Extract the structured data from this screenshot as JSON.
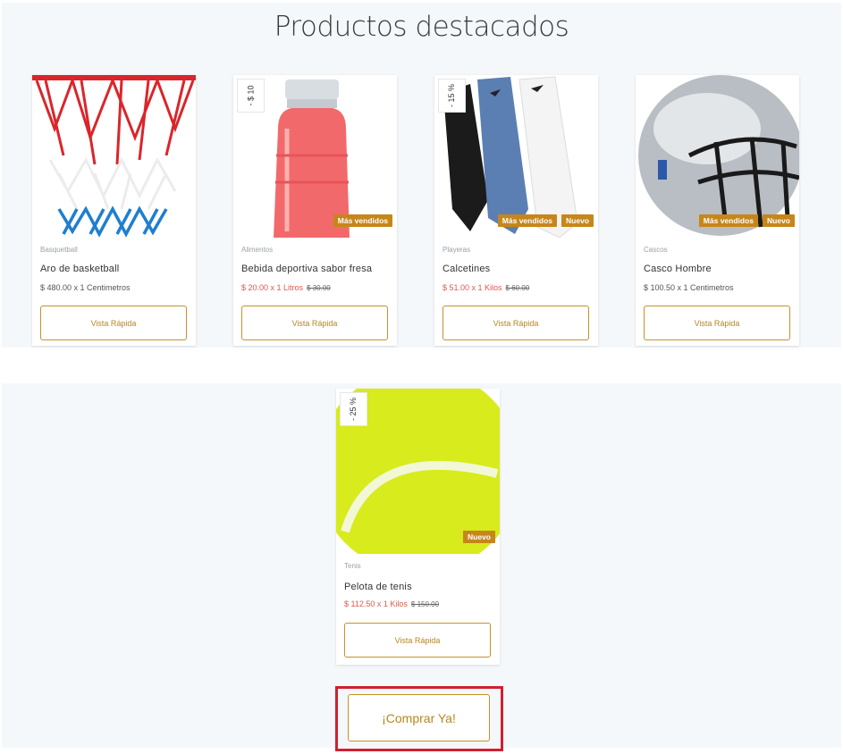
{
  "section": {
    "title": "Productos destacados"
  },
  "products": [
    {
      "category": "Basquetball",
      "name": "Aro de basketball",
      "price": "$ 480.00 x 1 Centimetros",
      "old_price": "",
      "discount": "",
      "badges": [],
      "quick_view": "Vista Rápida",
      "image_icon": "basketball-hoop-net"
    },
    {
      "category": "Alimentos",
      "name": "Bebida deportiva sabor fresa",
      "price": "$ 20.00 x 1 Litros",
      "old_price": "$ 30.00",
      "discount": "- $ 10",
      "badges": [
        "Más vendidos"
      ],
      "quick_view": "Vista Rápida",
      "image_icon": "pink-sports-drink-bottle"
    },
    {
      "category": "Playeras",
      "name": "Calcetines",
      "price": "$ 51.00 x 1 Kilos",
      "old_price": "$ 60.00",
      "discount": "- 15 %",
      "badges": [
        "Más vendidos",
        "Nuevo"
      ],
      "quick_view": "Vista Rápida",
      "image_icon": "socks"
    },
    {
      "category": "Cascos",
      "name": "Casco Hombre",
      "price": "$ 100.50 x 1 Centimetros",
      "old_price": "",
      "discount": "",
      "badges": [
        "Más vendidos",
        "Nuevo"
      ],
      "quick_view": "Vista Rápida",
      "image_icon": "football-helmet"
    },
    {
      "category": "Tenis",
      "name": "Pelota de tenis",
      "price": "$ 112.50 x 1 Kilos",
      "old_price": "$ 150.00",
      "discount": "- 25 %",
      "badges": [
        "Nuevo"
      ],
      "quick_view": "Vista Rápida",
      "image_icon": "tennis-ball"
    }
  ],
  "cta": {
    "label": "¡Comprar Ya!"
  },
  "colors": {
    "accent": "#c7861a",
    "sale_price": "#e2574c",
    "highlight": "#d0202f",
    "band": "#f5f8fb"
  }
}
